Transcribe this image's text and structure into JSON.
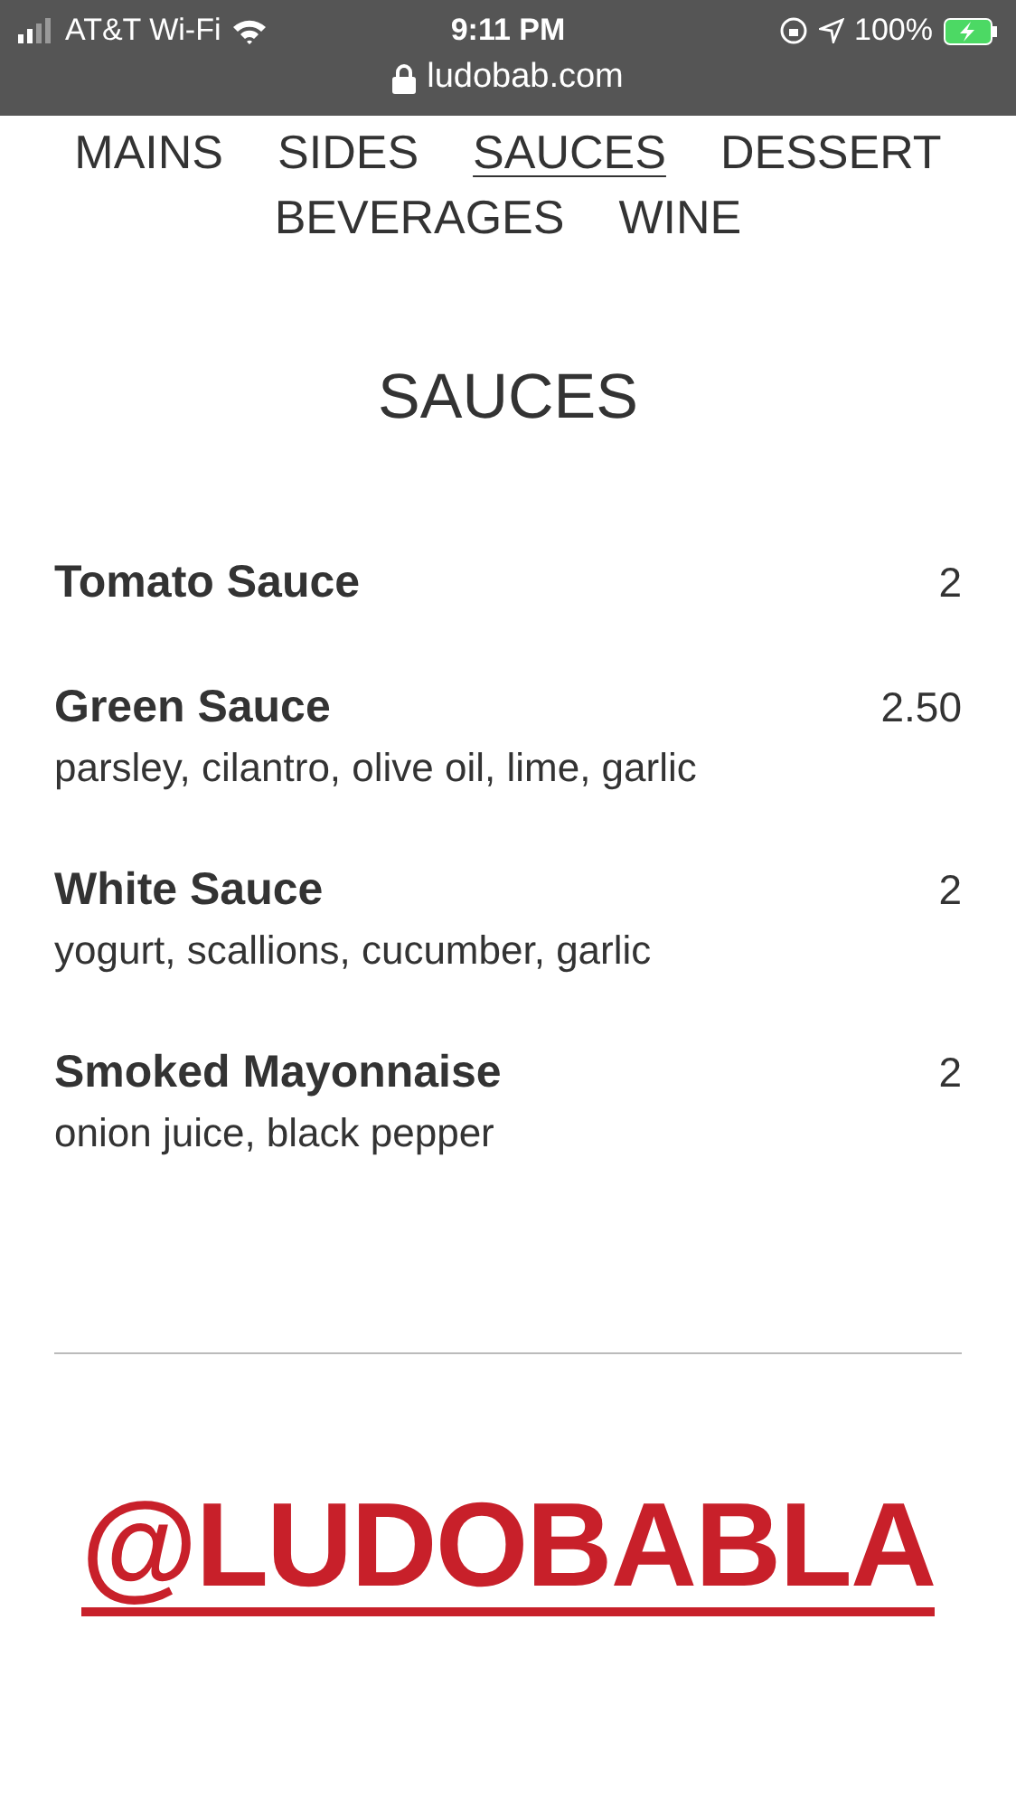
{
  "status_bar": {
    "carrier": "AT&T Wi-Fi",
    "time": "9:11 PM",
    "battery": "100%",
    "url": "ludobab.com"
  },
  "nav": [
    {
      "label": "MAINS",
      "selected": false
    },
    {
      "label": "SIDES",
      "selected": false
    },
    {
      "label": "SAUCES",
      "selected": true
    },
    {
      "label": "DESSERT",
      "selected": false
    },
    {
      "label": "BEVERAGES",
      "selected": false
    },
    {
      "label": "WINE",
      "selected": false
    }
  ],
  "section_title": "SAUCES",
  "items": [
    {
      "name": "Tomato Sauce",
      "price": "2"
    },
    {
      "name": "Green Sauce",
      "price": "2.50",
      "description": "parsley, cilantro, olive oil, lime, garlic"
    },
    {
      "name": "White Sauce",
      "price": "2",
      "description": "yogurt, scallions, cucumber, garlic"
    },
    {
      "name": "Smoked Mayonnaise",
      "price": "2",
      "description": "onion juice, black pepper"
    }
  ],
  "social_handle": "@LUDOBABLA"
}
